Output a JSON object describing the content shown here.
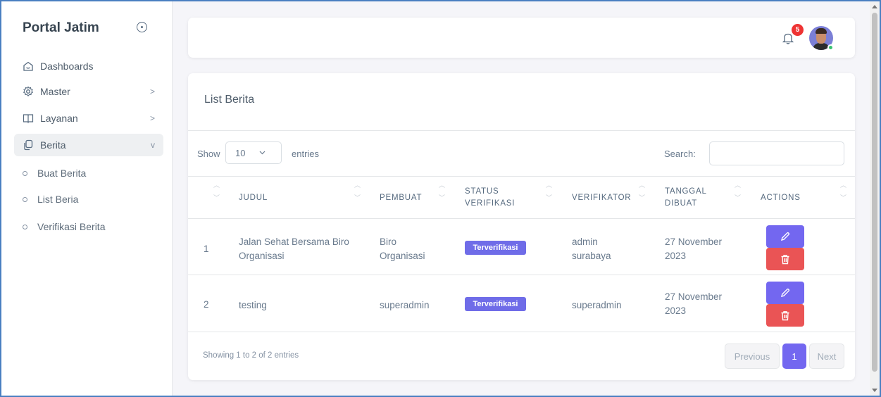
{
  "sidebar": {
    "brand": "Portal Jatim",
    "menu": [
      {
        "label": "Dashboards",
        "icon": "home-icon"
      },
      {
        "label": "Master",
        "icon": "gear-icon",
        "chevron": ">"
      },
      {
        "label": "Layanan",
        "icon": "book-icon",
        "chevron": ">"
      },
      {
        "label": "Berita",
        "icon": "copy-icon",
        "chevron": "v",
        "active": true
      }
    ],
    "submenu": [
      "Buat Berita",
      "List Beria",
      "Verifikasi Berita"
    ]
  },
  "navbar": {
    "notification_count": "5"
  },
  "card": {
    "title": "List Berita",
    "show_label": "Show",
    "page_length": "10",
    "entries_label": "entries",
    "search_label": "Search:",
    "search_value": ""
  },
  "table": {
    "headers": [
      "JUDUL",
      "PEMBUAT",
      "STATUS VERIFIKASI",
      "VERIFIKATOR",
      "TANGGAL DIBUAT",
      "ACTIONS"
    ],
    "header_lines": {
      "status": [
        "STATUS",
        "VERIFIKASI"
      ],
      "tanggal": [
        "TANGGAL",
        "DIBUAT"
      ]
    },
    "rows": [
      {
        "no": "1",
        "judul": [
          "Jalan Sehat Bersama Biro",
          "Organisasi"
        ],
        "pembuat": [
          "Biro",
          "Organisasi"
        ],
        "status": "Terverifikasi",
        "verifikator": [
          "admin",
          "surabaya"
        ],
        "tanggal": [
          "27 November",
          "2023"
        ]
      },
      {
        "no": "2",
        "judul": [
          "testing"
        ],
        "pembuat": [
          "superadmin"
        ],
        "status": "Terverifikasi",
        "verifikator": [
          "superadmin"
        ],
        "tanggal": [
          "27 November",
          "2023"
        ]
      }
    ]
  },
  "footer": {
    "info": "Showing 1 to 2 of 2 entries",
    "previous": "Previous",
    "current_page": "1",
    "next": "Next"
  },
  "colors": {
    "accent": "#7367f0",
    "danger": "#ea5455",
    "badge": "#6f6ce8"
  }
}
